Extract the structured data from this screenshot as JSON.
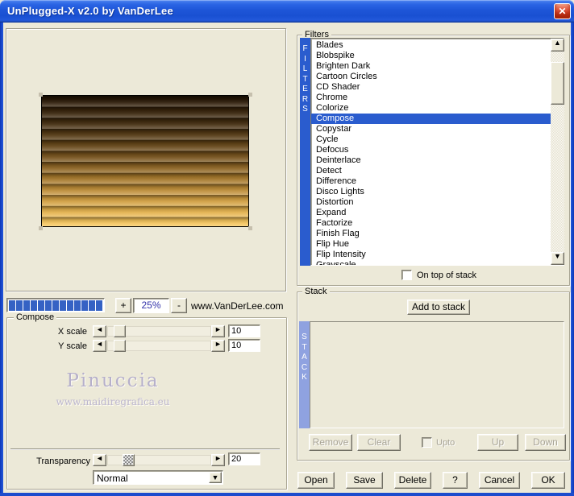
{
  "window": {
    "title": "UnPlugged-X v2.0 by VanDerLee"
  },
  "glyphs": {
    "close": "✕",
    "arrow_left": "◄",
    "arrow_right": "►",
    "arrow_up": "▲",
    "arrow_down": "▼",
    "dropdown": "▼"
  },
  "zoom_bar": {
    "progress_segments": 13,
    "plus_label": "+",
    "zoom_value": "25%",
    "minus_label": "-",
    "site_text": "www.VanDerLee.com"
  },
  "filters": {
    "group_label": "Filters",
    "vertical_label": "FILTERS",
    "items": [
      "Blades",
      "Blobspike",
      "Brighten Dark",
      "Cartoon Circles",
      "CD Shader",
      "Chrome",
      "Colorize",
      "Compose",
      "Copystar",
      "Cycle",
      "Defocus",
      "Deinterlace",
      "Detect",
      "Difference",
      "Disco Lights",
      "Distortion",
      "Expand",
      "Factorize",
      "Finish Flag",
      "Flip Hue",
      "Flip Intensity",
      "Grayscale"
    ],
    "selected": "Compose",
    "on_top_label": "On top of stack"
  },
  "compose": {
    "group_label": "Compose",
    "x_scale_label": "X scale",
    "x_scale_value": "10",
    "y_scale_label": "Y scale",
    "y_scale_value": "10",
    "transparency_label": "Transparency",
    "transparency_value": "20",
    "blend_mode": "Normal"
  },
  "watermark": {
    "title": "Pinuccia",
    "url": "www.maidiregrafica.eu"
  },
  "stack": {
    "group_label": "Stack",
    "vertical_label": "STACK",
    "add_label": "Add to stack",
    "remove_label": "Remove",
    "clear_label": "Clear",
    "upto_label": "Upto",
    "up_label": "Up",
    "down_label": "Down"
  },
  "actions": {
    "open_label": "Open",
    "save_label": "Save",
    "delete_label": "Delete",
    "help_label": "?",
    "cancel_label": "Cancel",
    "ok_label": "OK"
  },
  "colors": {
    "selection_blue": "#2a5cce",
    "stack_bar_blue": "#8fa2e0",
    "progress_blue": "#3562c4",
    "titlebar_blue": "#1e56d6",
    "window_face": "#ece9d8"
  }
}
